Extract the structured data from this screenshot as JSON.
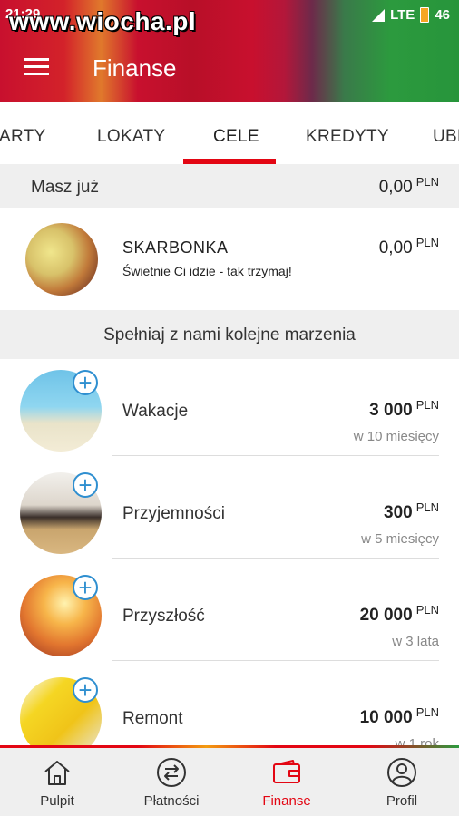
{
  "status_bar": {
    "time": "21:29",
    "network": "LTE",
    "battery": "46"
  },
  "watermark": "www.wiocha.pl",
  "header": {
    "title": "Finanse"
  },
  "tabs": [
    {
      "label": "KARTY"
    },
    {
      "label": "LOKATY"
    },
    {
      "label": "CELE"
    },
    {
      "label": "KREDYTY"
    },
    {
      "label": "UBE"
    }
  ],
  "summary": {
    "label": "Masz już",
    "amount": "0,00",
    "currency": "PLN"
  },
  "piggy_bank": {
    "name": "SKARBONKA",
    "subtitle": "Świetnie Ci idzie - tak trzymaj!",
    "amount": "0,00",
    "currency": "PLN"
  },
  "section_title": "Spełniaj z nami kolejne marzenia",
  "goals": [
    {
      "name": "Wakacje",
      "amount": "3 000",
      "currency": "PLN",
      "period": "w 10 miesięcy"
    },
    {
      "name": "Przyjemności",
      "amount": "300",
      "currency": "PLN",
      "period": "w 5 miesięcy"
    },
    {
      "name": "Przyszłość",
      "amount": "20 000",
      "currency": "PLN",
      "period": "w 3 lata"
    },
    {
      "name": "Remont",
      "amount": "10 000",
      "currency": "PLN",
      "period": "w 1 rok"
    }
  ],
  "bottom_nav": [
    {
      "label": "Pulpit",
      "icon": "home-icon"
    },
    {
      "label": "Płatności",
      "icon": "transfer-icon"
    },
    {
      "label": "Finanse",
      "icon": "wallet-icon",
      "active": true
    },
    {
      "label": "Profil",
      "icon": "profile-icon"
    }
  ],
  "colors": {
    "accent": "#e30613",
    "plus": "#2f8fd0",
    "header_green": "#2c9a3e"
  }
}
